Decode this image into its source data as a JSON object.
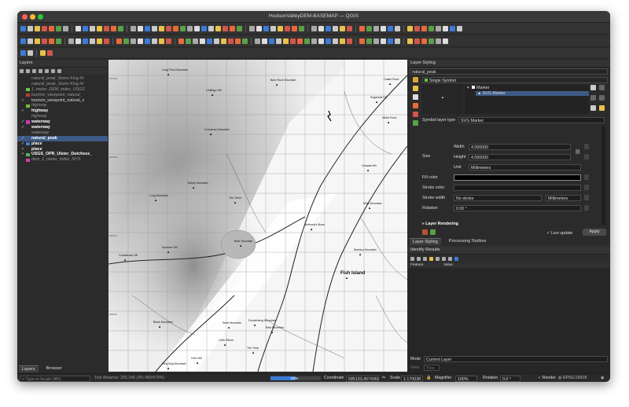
{
  "window": {
    "title": "HudsonValleyDEM-BASEMAP — QGIS"
  },
  "layers_panel": {
    "title": "Layers",
    "items": [
      {
        "name": "natural_peak_Storm King Hi",
        "style": "it",
        "color": "",
        "checked": false
      },
      {
        "name": "natural_peak_Storm King Hi",
        "style": "it",
        "color": "",
        "checked": false
      },
      {
        "name": "1_meter_DEM_index_USGS",
        "style": "it",
        "color": "#6fbf3b",
        "checked": false
      },
      {
        "name": "tourism_viewpoint_natural_",
        "style": "it",
        "color": "#c23b2e",
        "checked": false
      },
      {
        "name": "tourism_viewpoint_natural_v",
        "style": "",
        "color": "",
        "checked": true
      },
      {
        "name": "highway",
        "style": "it",
        "color": "#6fbf3b",
        "checked": false
      },
      {
        "name": "highway",
        "style": "bold",
        "color": "",
        "checked": true
      },
      {
        "name": "highway",
        "style": "it",
        "color": "",
        "checked": false
      },
      {
        "name": "waterway",
        "style": "bold",
        "color": "#c23bb4",
        "checked": true
      },
      {
        "name": "waterway",
        "style": "bold",
        "color": "",
        "checked": true
      },
      {
        "name": "waterway",
        "style": "it",
        "color": "",
        "checked": false
      },
      {
        "name": "natural_peak",
        "style": "bold",
        "color": "",
        "checked": true,
        "selected": true
      },
      {
        "name": "place",
        "style": "bold",
        "color": "#3b7bd6",
        "checked": true
      },
      {
        "name": "place",
        "style": "bold",
        "color": "",
        "checked": true
      },
      {
        "name": "USGS_OPR_Ulster_Dutchess_",
        "style": "bold",
        "color": "#5ab35a",
        "checked": true
      },
      {
        "name": "dem_1_meter_index_NYS",
        "style": "it",
        "color": "#d03fa5",
        "checked": false
      }
    ],
    "tabs": [
      "Layers",
      "Browser"
    ]
  },
  "map_labels": [
    {
      "t": "Long Pond Mountain"
    },
    {
      "t": "Bare Rock Mountain"
    },
    {
      "t": "Castle Rock"
    },
    {
      "t": "Linlithgo Hill"
    },
    {
      "t": "Sugarloaf Hill"
    },
    {
      "t": "White Rock"
    },
    {
      "t": "Cranberry Mountain"
    },
    {
      "t": "Turkey Mountain"
    },
    {
      "t": "Canada Hill"
    },
    {
      "t": "Long Mountain"
    },
    {
      "t": "The Torne"
    },
    {
      "t": "Mine Mountain"
    },
    {
      "t": "Anthony's Nose"
    },
    {
      "t": "Summer Hill"
    },
    {
      "t": "Bear Mountain"
    },
    {
      "t": "Manitou Mountain"
    },
    {
      "t": "Crankshaw Hill"
    },
    {
      "t": "Fish Island"
    },
    {
      "t": "Black Mountain"
    },
    {
      "t": "West Mountain"
    },
    {
      "t": "Dunderberg Mountain"
    },
    {
      "t": "Bald Mountain"
    },
    {
      "t": "Cat's Elbow"
    },
    {
      "t": "Horn Hill"
    },
    {
      "t": "The Timp"
    },
    {
      "t": "Ring Bog Mountain"
    }
  ],
  "styling": {
    "title": "Layer Styling",
    "layer": "natural_peak",
    "renderer": "Single Symbol",
    "tree_marker": "Marker",
    "tree_svg": "SVG Marker",
    "symbol_layer_type_label": "Symbol layer type",
    "symbol_layer_type": "SVG Marker",
    "size_label": "Size",
    "width_label": "Width",
    "width_value": "4.000000",
    "height_label": "Height",
    "height_value": "4.000000",
    "unit_label": "Unit",
    "unit_value": "Millimeters",
    "fill_color_label": "Fill color",
    "stroke_color_label": "Stroke color",
    "stroke_width_label": "Stroke width",
    "stroke_width_value": "No stroke",
    "stroke_unit": "Millimeters",
    "rotation_label": "Rotation",
    "rotation_value": "0.00 °",
    "layer_rendering": "Layer Rendering",
    "live_update": "Live update",
    "apply": "Apply",
    "tabs": [
      "Layer Styling",
      "Processing Toolbox"
    ]
  },
  "identify": {
    "title": "Identify Results",
    "col_feature": "Feature",
    "col_value": "Value",
    "mode_label": "Mode",
    "mode_value": "Current Layer",
    "view_label": "View",
    "view_value": "Tree"
  },
  "statusbar": {
    "locator_placeholder": "Type to locate (⌘K)",
    "message": "Tool distance: 255 240 (3% 480/479%)",
    "progress_pct": 0.5,
    "progress_text": "50%",
    "coordinate_label": "Coordinate",
    "coordinate": "585133,4574368",
    "scale_label": "Scale",
    "scale": "1:170038",
    "magnifier_label": "Magnifier",
    "magnifier": "100%",
    "rotation_label": "Rotation",
    "rotation": "0.0 °",
    "render_label": "Render",
    "crs": "EPSG:26918"
  },
  "colors": {
    "accent": "#3d5a86",
    "progress": "#3a7bd5",
    "fill_black": "#000000"
  }
}
